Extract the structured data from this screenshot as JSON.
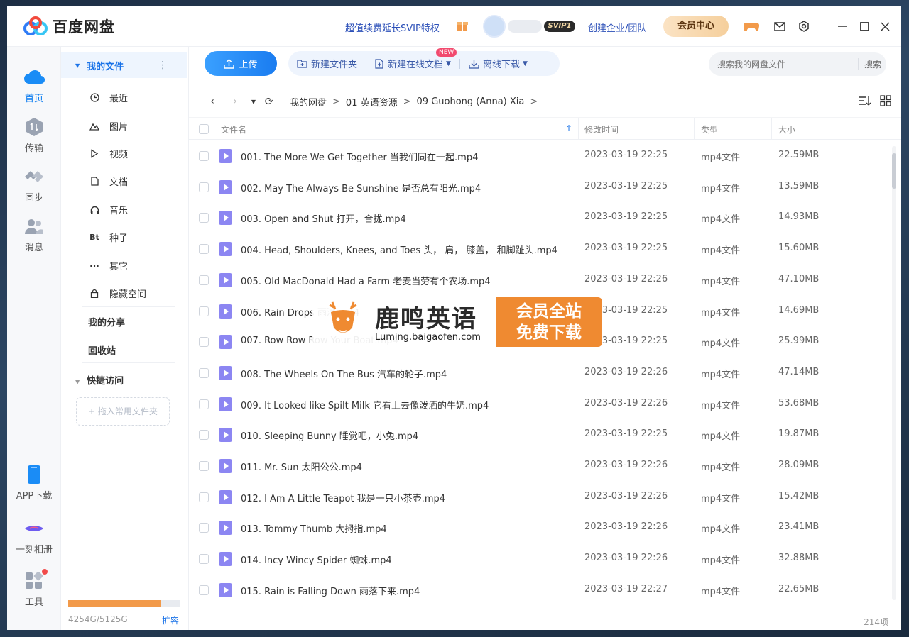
{
  "app": {
    "title": "百度网盘"
  },
  "titlebar": {
    "svip_link": "超值续费延长SVIP特权",
    "svip_badge": "SVIP1",
    "create_team": "创建企业/团队",
    "member_center": "会员中心"
  },
  "rail": [
    {
      "label": "首页",
      "icon": "cloud-home-icon",
      "active": true
    },
    {
      "label": "传输",
      "icon": "transfer-icon"
    },
    {
      "label": "同步",
      "icon": "sync-icon"
    },
    {
      "label": "消息",
      "icon": "message-icon"
    },
    {
      "label": "APP下载",
      "icon": "phone-icon"
    },
    {
      "label": "一刻相册",
      "icon": "album-icon"
    },
    {
      "label": "工具",
      "icon": "tools-icon"
    }
  ],
  "sidebar": {
    "my_files": "我的文件",
    "items": [
      {
        "label": "最近",
        "icon": "clock-icon"
      },
      {
        "label": "图片",
        "icon": "image-icon"
      },
      {
        "label": "视频",
        "icon": "video-icon"
      },
      {
        "label": "文档",
        "icon": "document-icon"
      },
      {
        "label": "音乐",
        "icon": "headphones-icon"
      },
      {
        "label": "种子",
        "icon": "bt-icon"
      },
      {
        "label": "其它",
        "icon": "more-icon"
      },
      {
        "label": "隐藏空间",
        "icon": "lock-icon"
      }
    ],
    "my_share": "我的分享",
    "recycle": "回收站",
    "quick_access": "快捷访问",
    "drag_hint": "+ 拖入常用文件夹",
    "storage_text": "4254G/5125G",
    "storage_used_fraction": 0.83,
    "expand": "扩容"
  },
  "toolbar": {
    "upload": "上传",
    "new_folder": "新建文件夹",
    "new_online_doc": "新建在线文档",
    "new_badge": "NEW",
    "offline_download": "离线下载",
    "search_placeholder": "搜索我的网盘文件",
    "search_button": "搜索"
  },
  "breadcrumb": [
    "我的网盘",
    "01 英语资源",
    "09 Guohong (Anna) Xia"
  ],
  "table": {
    "headers": {
      "name": "文件名",
      "time": "修改时间",
      "type": "类型",
      "size": "大小"
    },
    "rows": [
      {
        "name": "001. The More We Get Together  当我们同在一起.mp4",
        "time": "2023-03-19 22:25",
        "type": "mp4文件",
        "size": "22.59MB"
      },
      {
        "name": "002. May The Always Be Sunshine 是否总有阳光.mp4",
        "time": "2023-03-19 22:25",
        "type": "mp4文件",
        "size": "13.59MB"
      },
      {
        "name": "003. Open and Shut 打开，合拢.mp4",
        "time": "2023-03-19 22:25",
        "type": "mp4文件",
        "size": "14.93MB"
      },
      {
        "name": "004. Head, Shoulders, Knees, and Toes 头， 肩， 膝盖， 和脚趾头.mp4",
        "time": "2023-03-19 22:25",
        "type": "mp4文件",
        "size": "15.60MB"
      },
      {
        "name": "005. Old MacDonald Had a Farm 老麦当劳有个农场.mp4",
        "time": "2023-03-19 22:26",
        "type": "mp4文件",
        "size": "47.10MB"
      },
      {
        "name": "006. Rain Drops 雨滴.mp4",
        "time": "2023-03-19 22:25",
        "type": "mp4文件",
        "size": "14.69MB"
      },
      {
        "name": "007. Row Row Row Your Boat.mp4",
        "time": "2023-03-19 22:25",
        "type": "mp4文件",
        "size": "25.99MB"
      },
      {
        "name": "008. The Wheels On The Bus 汽车的轮子.mp4",
        "time": "2023-03-19 22:26",
        "type": "mp4文件",
        "size": "47.14MB"
      },
      {
        "name": "009. It Looked like Spilt Milk 它看上去像泼洒的牛奶.mp4",
        "time": "2023-03-19 22:26",
        "type": "mp4文件",
        "size": "53.68MB"
      },
      {
        "name": "010. Sleeping Bunny 睡觉吧，小兔.mp4",
        "time": "2023-03-19 22:25",
        "type": "mp4文件",
        "size": "19.87MB"
      },
      {
        "name": "011. Mr. Sun 太阳公公.mp4",
        "time": "2023-03-19 22:26",
        "type": "mp4文件",
        "size": "28.09MB"
      },
      {
        "name": "012. I Am A Little Teapot 我是一只小茶壶.mp4",
        "time": "2023-03-19 22:26",
        "type": "mp4文件",
        "size": "15.42MB"
      },
      {
        "name": "013. Tommy Thumb 大拇指.mp4",
        "time": "2023-03-19 22:26",
        "type": "mp4文件",
        "size": "23.41MB"
      },
      {
        "name": "014. Incy Wincy Spider 蜘蛛.mp4",
        "time": "2023-03-19 22:26",
        "type": "mp4文件",
        "size": "32.88MB"
      },
      {
        "name": "015. Rain is Falling Down 雨落下来.mp4",
        "time": "2023-03-19 22:27",
        "type": "mp4文件",
        "size": "22.65MB"
      }
    ],
    "count": "214项"
  },
  "watermark": {
    "title": "鹿鸣英语",
    "url": "Luming.baigaofen.com",
    "line1": "会员全站",
    "line2": "免费下载"
  },
  "colors": {
    "accent": "#1a7cf0",
    "file_icon": "#8c86f2",
    "storage": "#f29a4a",
    "watermark": "#ef8a31"
  }
}
